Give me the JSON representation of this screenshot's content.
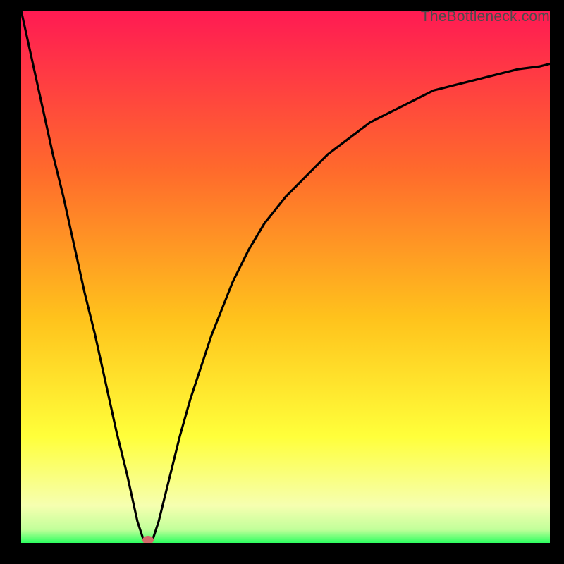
{
  "watermark": "TheBottleneck.com",
  "colors": {
    "gradient_top": "#ff1a53",
    "gradient_upper": "#ff6a2c",
    "gradient_mid": "#ffc31c",
    "gradient_low": "#ffff3a",
    "gradient_pale": "#f6ffb0",
    "gradient_green": "#2eff60",
    "curve_stroke": "#000000",
    "marker_fill": "#d46a6a",
    "background": "#000000"
  },
  "chart_data": {
    "type": "line",
    "title": "",
    "xlabel": "",
    "ylabel": "",
    "xlim": [
      0,
      100
    ],
    "ylim": [
      0,
      100
    ],
    "x": [
      0,
      2,
      4,
      6,
      8,
      10,
      12,
      14,
      16,
      18,
      20,
      22,
      23,
      24,
      25,
      26,
      28,
      30,
      32,
      34,
      36,
      38,
      40,
      43,
      46,
      50,
      54,
      58,
      62,
      66,
      70,
      74,
      78,
      82,
      86,
      90,
      94,
      98,
      100
    ],
    "values": [
      100,
      91,
      82,
      73,
      65,
      56,
      47,
      39,
      30,
      21,
      13,
      4,
      1,
      0,
      1,
      4,
      12,
      20,
      27,
      33,
      39,
      44,
      49,
      55,
      60,
      65,
      69,
      73,
      76,
      79,
      81,
      83,
      85,
      86,
      87,
      88,
      89,
      89.5,
      90
    ],
    "marker": {
      "x": 24,
      "y": 0
    },
    "grid": false,
    "gradient_stops": [
      {
        "offset": 0.0,
        "color": "#ff1a53"
      },
      {
        "offset": 0.3,
        "color": "#ff6a2c"
      },
      {
        "offset": 0.58,
        "color": "#ffc31c"
      },
      {
        "offset": 0.8,
        "color": "#ffff3a"
      },
      {
        "offset": 0.93,
        "color": "#f6ffb0"
      },
      {
        "offset": 0.975,
        "color": "#c2ff9a"
      },
      {
        "offset": 1.0,
        "color": "#2eff60"
      }
    ]
  }
}
